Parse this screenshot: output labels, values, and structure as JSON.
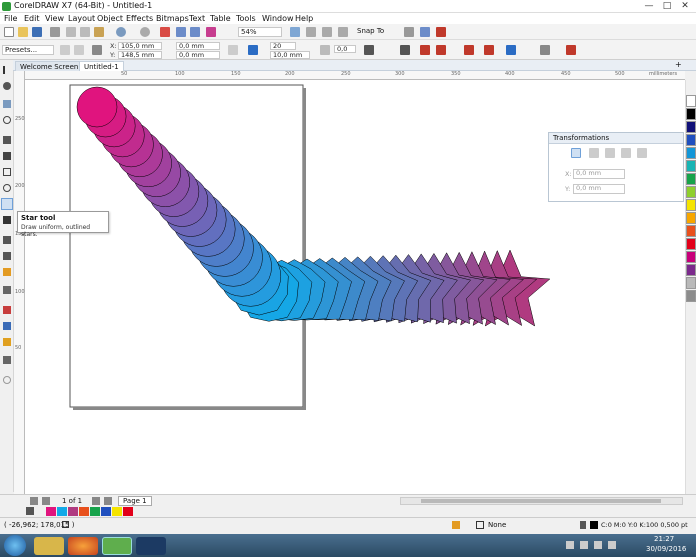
{
  "window": {
    "title": "CorelDRAW X7 (64-Bit) - Untitled-1",
    "minimize": "—",
    "maximize": "□",
    "close": "✕"
  },
  "menu": [
    "File",
    "Edit",
    "View",
    "Layout",
    "Object",
    "Effects",
    "Bitmaps",
    "Text",
    "Table",
    "Tools",
    "Window",
    "Help"
  ],
  "toolbar": {
    "zoom": "54%",
    "snap_to": "Snap To"
  },
  "propbar": {
    "presets": "Presets...",
    "x_label": "X:",
    "x_value": "105,0 mm",
    "y_label": "Y:",
    "y_value": "148,5 mm",
    "w_value": "0,0 mm",
    "h_value": "0,0 mm",
    "points": "20",
    "sharpness": "10,0 mm",
    "angle": "0,0"
  },
  "tabs": [
    "Welcome Screen",
    "Untitled-1"
  ],
  "ruler": {
    "top_ticks": [
      "0",
      "50",
      "100",
      "150",
      "200",
      "250",
      "300",
      "350",
      "400",
      "450",
      "500"
    ],
    "unit": "millimeters",
    "left_ticks": [
      "250",
      "200",
      "150",
      "100",
      "50"
    ]
  },
  "tooltip": {
    "title": "Star tool",
    "description": "Draw uniform, outlined stars."
  },
  "transform_panel": {
    "title": "Transformations",
    "x_label": "X:",
    "x_value": "0,0 mm",
    "y_label": "Y:",
    "y_value": "0,0 mm"
  },
  "pagebar": {
    "page_count": "1 of 1",
    "page_tab": "Page 1"
  },
  "status": {
    "coordinates": "( -26,962; 178,015 )",
    "fill_none": "None",
    "outline_info": "C:0 M:0 Y:0 K:100  0,500 pt"
  },
  "clock": {
    "time": "21:27",
    "date": "30/09/2016"
  },
  "colors": {
    "start": "#e0147e",
    "middle": "#12a9e8",
    "end": "#b03a80",
    "outline": "#000000"
  },
  "palette": [
    "#ffffff",
    "#000000",
    "#101078",
    "#1f4fbf",
    "#1296d8",
    "#18b4b4",
    "#17a34b",
    "#8fcf2e",
    "#f5e400",
    "#f7a600",
    "#e8501c",
    "#e2001a",
    "#c8007a",
    "#7b2a8c",
    "#b9b9b9",
    "#8c8c8c"
  ],
  "doc_palette": [
    "#e0147e",
    "#12a9e8",
    "#b03a80",
    "#e8501c",
    "#17a34b",
    "#1f4fbf",
    "#f5e400",
    "#e2001a"
  ],
  "taskbar": [
    "explorer",
    "folder",
    "firefox",
    "coreldraw",
    "photoshop"
  ]
}
